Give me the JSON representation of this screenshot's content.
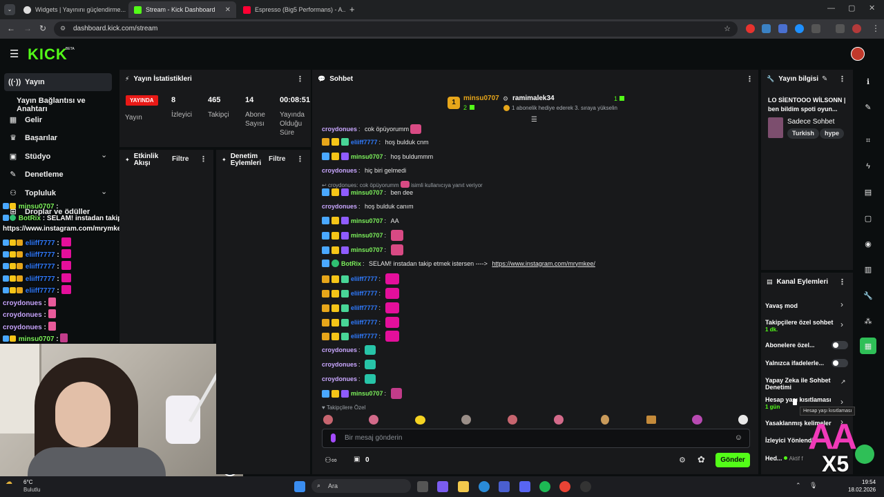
{
  "browser": {
    "tabs": [
      {
        "title": "Widgets | Yayınını güçlendirme..."
      },
      {
        "title": "Stream - Kick Dashboard"
      },
      {
        "title": "Espresso (Big5 Performans) - A..."
      }
    ],
    "url": "dashboard.kick.com/stream"
  },
  "kick": {
    "logo": "KICK",
    "beta": "BETA"
  },
  "nav": {
    "items": [
      {
        "label": "Yayın",
        "icon": "broadcast-icon"
      },
      {
        "label": "Yayın Bağlantısı ve Anahtarı"
      },
      {
        "label": "Gelir",
        "icon": "revenue-icon"
      },
      {
        "label": "Başarılar",
        "icon": "trophy-icon"
      },
      {
        "label": "Stüdyo",
        "icon": "studio-icon"
      },
      {
        "label": "Denetleme",
        "icon": "moderation-icon"
      },
      {
        "label": "Topluluk",
        "icon": "community-icon"
      },
      {
        "label": "Droplar ve ödüller",
        "icon": "gift-icon"
      }
    ]
  },
  "overlay_chat": [
    {
      "user": "minsu0707",
      "sep": ":"
    },
    {
      "user": "BotRix",
      "sep": ":",
      "text": "SELAM! instadan takip etmek istersen ---->"
    },
    {
      "text": "https://www.instagram.com/mrymkee/"
    },
    {
      "user": "eliiff7777",
      "sep": ":"
    },
    {
      "user": "eliiff7777",
      "sep": ":"
    },
    {
      "user": "eliiff7777",
      "sep": ":"
    },
    {
      "user": "eliiff7777",
      "sep": ":"
    },
    {
      "user": "eliiff7777",
      "sep": ":"
    },
    {
      "user": "croydonues",
      "sep": ":"
    },
    {
      "user": "croydonues",
      "sep": ":"
    },
    {
      "user": "croydonues",
      "sep": ":"
    },
    {
      "user": "minsu0707",
      "sep": ":"
    }
  ],
  "stats": {
    "title": "Yayın İstatistikleri",
    "live": "YAYINDA",
    "live_label": "Yayın",
    "viewers": "8",
    "viewers_label": "İzleyici",
    "followers": "465",
    "followers_label": "Takipçi",
    "subs": "14",
    "subs_label": "Abone Sayısı",
    "uptime": "00:08:51",
    "uptime_label": "Yayında Olduğu Süre"
  },
  "activity": {
    "title": "Etkinlik Akışı",
    "filter": "Filtre"
  },
  "modactions": {
    "title": "Denetim Eylemleri",
    "filter": "Filtre"
  },
  "chat": {
    "title": "Sohbet",
    "pinned": {
      "rank": "1",
      "user": "minsu0707",
      "count": "2",
      "gifter": "ramimalek34",
      "gift_count": "1",
      "gift_text": "1 abonelik hediye ederek 3. sıraya yükselin"
    },
    "messages": [
      {
        "user": "croydonues",
        "sep": ":",
        "text": "cok öpüyorumm"
      },
      {
        "user": "eliiff7777",
        "sep": ":",
        "text": "hoş bulduk cnm"
      },
      {
        "user": "minsu0707",
        "sep": ":",
        "text": "hoş buldummm"
      },
      {
        "user": "croydonues",
        "sep": ":",
        "text": "hiç biri gelmedi"
      },
      {
        "reply": "croydonues: cok öpüyorumm",
        "reply_suffix": "isimli kullanıcıya yanıt veriyor",
        "user": "minsu0707",
        "sep": ":",
        "text": "ben dee"
      },
      {
        "user": "croydonues",
        "sep": ":",
        "text": "hoş bulduk canım"
      },
      {
        "user": "minsu0707",
        "sep": ":",
        "text": "AA"
      },
      {
        "user": "minsu0707",
        "sep": ":",
        "text": ""
      },
      {
        "user": "minsu0707",
        "sep": ":",
        "text": ""
      },
      {
        "user": "BotRix",
        "sep": ":",
        "text": "SELAM! instadan takip etmek istersen ---->",
        "link": "https://www.instagram.com/mrymkee/"
      },
      {
        "user": "eliiff7777",
        "sep": ":",
        "text": ""
      },
      {
        "user": "eliiff7777",
        "sep": ":",
        "text": ""
      },
      {
        "user": "eliiff7777",
        "sep": ":",
        "text": ""
      },
      {
        "user": "eliiff7777",
        "sep": ":",
        "text": ""
      },
      {
        "user": "eliiff7777",
        "sep": ":",
        "text": ""
      },
      {
        "user": "croydonues",
        "sep": ":",
        "text": ""
      },
      {
        "user": "croydonues",
        "sep": ":",
        "text": ""
      },
      {
        "user": "croydonues",
        "sep": ":",
        "text": ""
      },
      {
        "user": "minsu0707",
        "sep": ":",
        "text": ""
      }
    ],
    "followers_only": "Takipçilere Özel",
    "placeholder": "Bir mesaj gönderin",
    "points": "0",
    "send": "Gönder"
  },
  "stream_info": {
    "title": "Yayın bilgisi",
    "stream_title": "LO SİENTOOO WİLSONN | ben bildim spoti oyun...",
    "category": "Sadece Sohbet",
    "tags": [
      "Turkish",
      "hype"
    ]
  },
  "channel_actions": {
    "title": "Kanal Eylemleri",
    "items": [
      {
        "label": "Yavaş mod"
      },
      {
        "label": "Takipçilere özel sohbet",
        "sub": "1 dk."
      },
      {
        "label": "Abonelere özel..."
      },
      {
        "label": "Yalnızca ifadelerle..."
      },
      {
        "label": "Yapay Zeka ile Sohbet Denetimi"
      },
      {
        "label": "Hesap yaşı kısıtlaması",
        "sub": "1 gün"
      },
      {
        "label": "Yasaklanmış kelimeler"
      },
      {
        "label": "İzleyici Yönlendir"
      },
      {
        "label": "Hed...",
        "sub": "Aktif f"
      }
    ],
    "tooltip": "Hesap yaşı kısıtlaması"
  },
  "overlay_art": {
    "text": "AA",
    "multiplier": "X5"
  },
  "taskbar": {
    "weather_temp": "6°C",
    "weather_desc": "Bulutlu",
    "search": "Ara",
    "time": "19:54",
    "date": "18.02.2026"
  }
}
